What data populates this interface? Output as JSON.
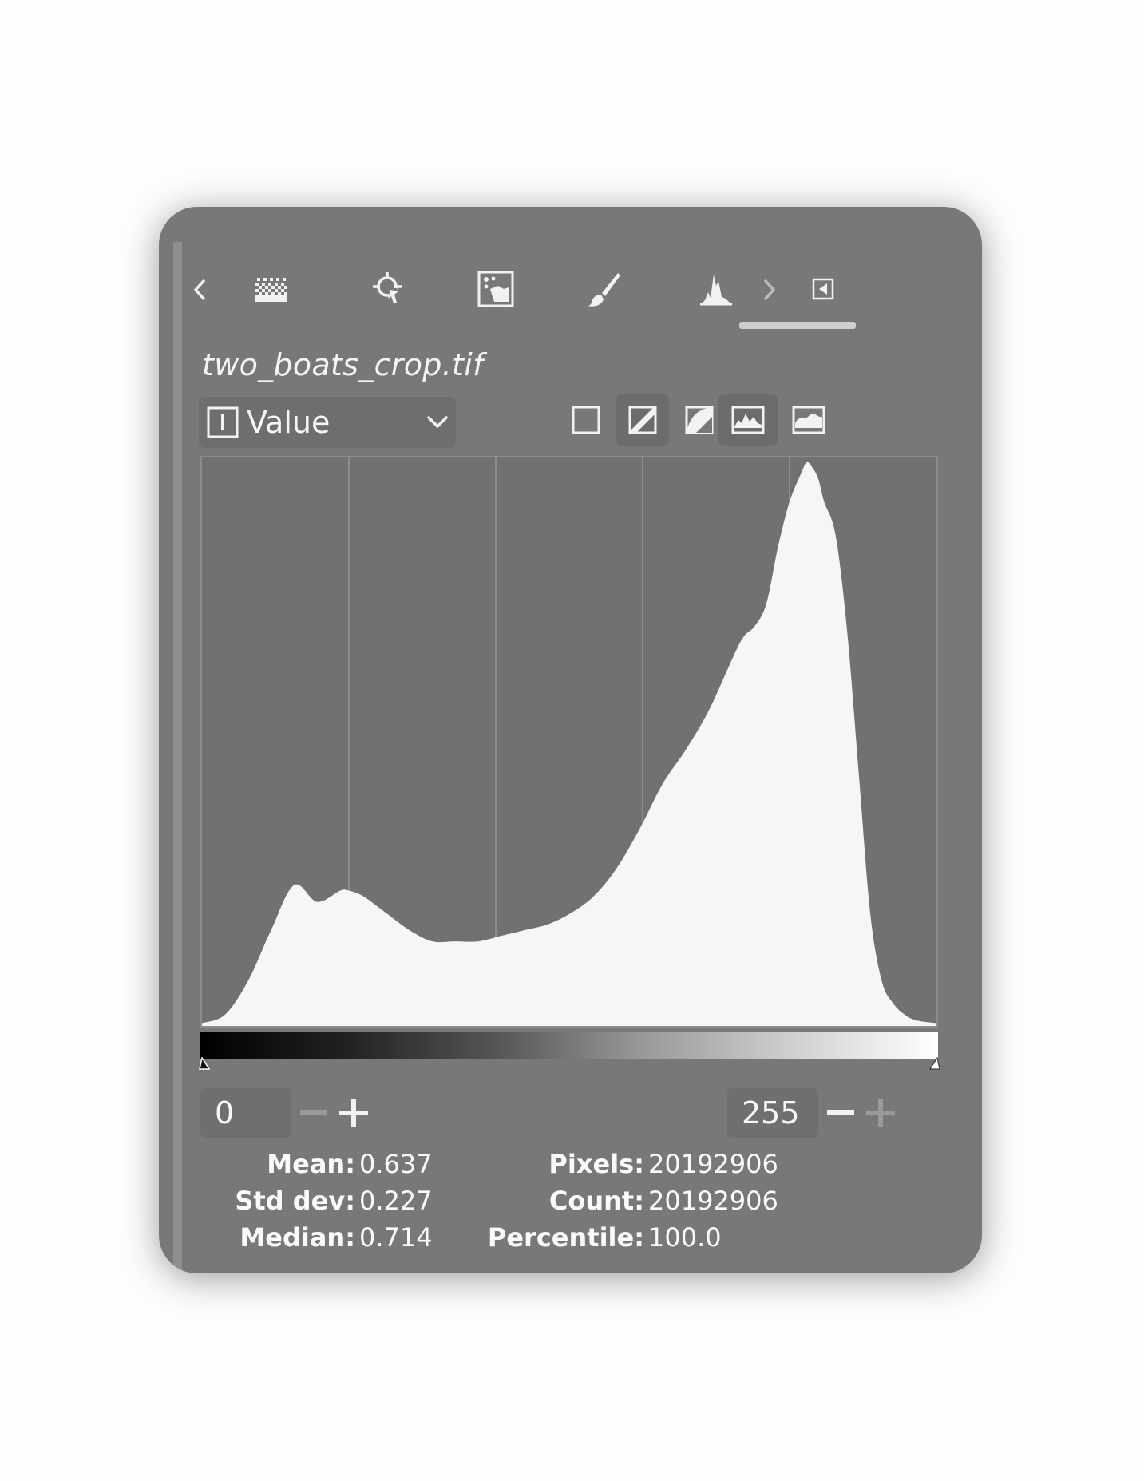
{
  "toolbar": {
    "tabs": [
      {
        "icon": "pattern-icon"
      },
      {
        "icon": "pointer-icon"
      },
      {
        "icon": "image-preview-icon"
      },
      {
        "icon": "brush-icon"
      },
      {
        "icon": "histogram-icon",
        "active": true
      }
    ]
  },
  "image": {
    "filename": "two_boats_crop.tif"
  },
  "channel": {
    "selected": "Value"
  },
  "display_modes": {
    "linear_active": true,
    "logarithmic_active": false
  },
  "range": {
    "low": "0",
    "high": "255"
  },
  "stats": {
    "left": [
      {
        "label": "Mean:",
        "value": "0.637"
      },
      {
        "label": "Std dev:",
        "value": "0.227"
      },
      {
        "label": "Median:",
        "value": "0.714"
      }
    ],
    "right": [
      {
        "label": "Pixels:",
        "value": "20192906"
      },
      {
        "label": "Count:",
        "value": "20192906"
      },
      {
        "label": "Percentile:",
        "value": "100.0"
      }
    ]
  },
  "chart_data": {
    "type": "area",
    "xlim": [
      0,
      255
    ],
    "ylim": [
      0,
      1
    ],
    "x": [
      0,
      8,
      16,
      24,
      32,
      40,
      48,
      51,
      56,
      64,
      72,
      80,
      88,
      96,
      104,
      112,
      120,
      128,
      136,
      144,
      152,
      160,
      168,
      176,
      184,
      188,
      192,
      196,
      200,
      204,
      208,
      210,
      212,
      214,
      216,
      220,
      224,
      228,
      232,
      236,
      240,
      244,
      248,
      255
    ],
    "y": [
      0.005,
      0.02,
      0.08,
      0.17,
      0.25,
      0.22,
      0.24,
      0.24,
      0.23,
      0.2,
      0.17,
      0.15,
      0.15,
      0.15,
      0.16,
      0.17,
      0.18,
      0.2,
      0.23,
      0.28,
      0.35,
      0.43,
      0.49,
      0.56,
      0.65,
      0.69,
      0.71,
      0.75,
      0.85,
      0.93,
      0.98,
      1.0,
      0.99,
      0.97,
      0.93,
      0.87,
      0.7,
      0.45,
      0.2,
      0.08,
      0.04,
      0.02,
      0.01,
      0.005
    ]
  }
}
